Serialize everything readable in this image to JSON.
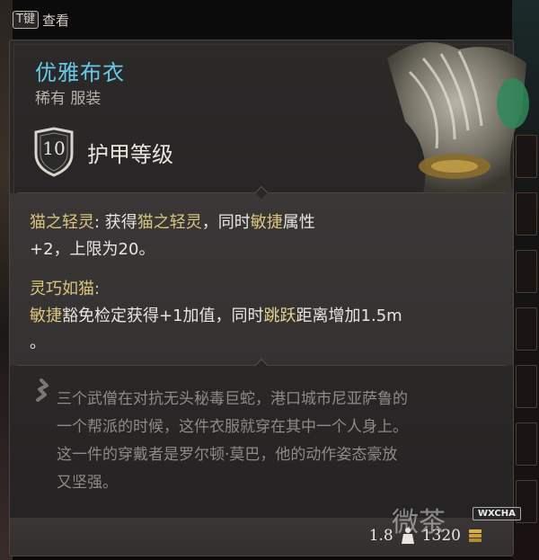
{
  "hint": {
    "key": "T键",
    "label": "查看"
  },
  "item": {
    "name": "优雅布衣",
    "rarity": "稀有",
    "category": "服装",
    "armor_class_value": "10",
    "armor_class_label": "护甲等级"
  },
  "effects": {
    "effect1_name": "猫之轻灵",
    "effect1_sep": ": 获得",
    "effect1_link": "猫之轻灵",
    "effect1_mid": "，同时",
    "effect1_stat": "敏捷",
    "effect1_tail": "属性",
    "effect1_line2": "+2，上限为20。",
    "effect2_name": "灵巧如猫:",
    "effect2_stat": "敏捷",
    "effect2_a": "豁免检定获得+1加值，同时",
    "effect2_hl": "跳跃",
    "effect2_b": "距离增加1.5m",
    "effect2_line2": "。"
  },
  "flavor": {
    "line1": "三个武僧在对抗无头秘毒巨蛇，港口城市尼亚萨鲁的",
    "line2": "一个帮派的时候，这件衣服就穿在其中一个人身上。",
    "line3": "这一件的穿戴者是罗尔顿·莫巴，他的动作姿态豪放",
    "line4": "又坚强。"
  },
  "footer": {
    "weight": "1.8",
    "value": "1320"
  },
  "watermark": {
    "logo": "微茶",
    "badge": "WXCHA"
  },
  "colors": {
    "title": "#69c7e8",
    "gold": "#d9c47c",
    "panel": "#2c2a29"
  }
}
